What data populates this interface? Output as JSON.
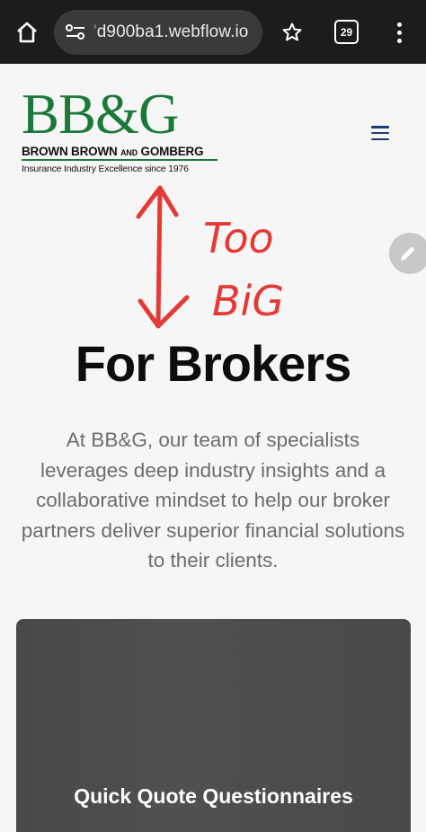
{
  "browser": {
    "url_prefix": "d900ba1.webflow.io",
    "tab_count": "29",
    "icons": [
      "home-icon",
      "site-settings-icon",
      "star-icon",
      "tab-switcher-icon",
      "more-icon"
    ]
  },
  "logo": {
    "mark": "BB&G",
    "line1_a": "BROWN BROWN ",
    "line1_small": "AND",
    "line1_b": " GOMBERG",
    "tagline": "Insurance Industry Excellence since 1976",
    "color": "#1b7a3a"
  },
  "annotation": {
    "line1": "Too",
    "line2": "BiG",
    "color": "#e53935"
  },
  "hero": {
    "title": "For Brokers",
    "description": "At BB&G, our team of specialists leverages deep industry insights and a collaborative mindset to help our broker partners deliver superior financial solutions to their clients."
  },
  "card": {
    "title": "Quick Quote Questionnaires"
  },
  "colors": {
    "nav_icon": "#1f3b73",
    "topbar": "#1c1c1e"
  }
}
